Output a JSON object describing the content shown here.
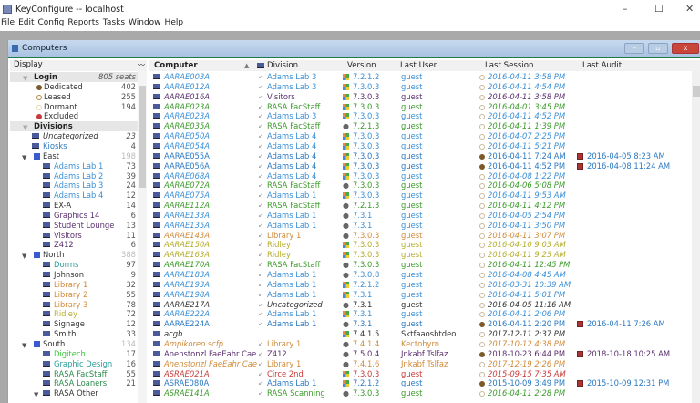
{
  "window": {
    "title": "KeyConfigure -- localhost",
    "minimize": "–",
    "maximize": "☐",
    "close": "✕"
  },
  "menu": [
    "File",
    "Edit",
    "Config",
    "Reports",
    "Tasks",
    "Window",
    "Help"
  ],
  "inner_window": {
    "title": "Computers",
    "min": "–",
    "max": "▫",
    "close": "x"
  },
  "colors": {
    "blue": "#3a8fd6",
    "dblue": "#2a78c2",
    "purple": "#5a2f6e",
    "green": "#3a9a2a",
    "orange": "#d08a3a",
    "olive": "#b5ad2c",
    "dark": "#333333",
    "red": "#c83a3a",
    "teal": "#2a9a9a",
    "lgreen": "#3ac83a",
    "dgreen": "#2a8a4a"
  },
  "left": {
    "header": "Display",
    "header_icon": "chart-wave-icon",
    "rows": [
      {
        "type": "section",
        "label": "Login",
        "count": "805 seats"
      },
      {
        "type": "login",
        "dot": "#7a5a2a",
        "label": "Dedicated",
        "count": "402"
      },
      {
        "type": "login",
        "dot": "#b08a40",
        "ring": true,
        "label": "Leased",
        "count": "255"
      },
      {
        "type": "login",
        "dot": "#e8d8b0",
        "ring": true,
        "label": "Dormant",
        "count": "194"
      },
      {
        "type": "login",
        "dot": "#c83a3a",
        "label": "Excluded",
        "count": ""
      },
      {
        "type": "section",
        "label": "Divisions",
        "count": ""
      },
      {
        "type": "div",
        "level": 0,
        "label": "Uncategorized",
        "count": "23",
        "color": "dark",
        "italic": true
      },
      {
        "type": "div",
        "level": 0,
        "label": "Kiosks",
        "count": "4",
        "color": "dblue"
      },
      {
        "type": "grp",
        "label": "East",
        "count": "198"
      },
      {
        "type": "div",
        "level": 1,
        "label": "Adams Lab 1",
        "count": "73",
        "color": "blue"
      },
      {
        "type": "div",
        "level": 1,
        "label": "Adams Lab 2",
        "count": "39",
        "color": "blue"
      },
      {
        "type": "div",
        "level": 1,
        "label": "Adams Lab 3",
        "count": "24",
        "color": "blue"
      },
      {
        "type": "div",
        "level": 1,
        "label": "Adams Lab 4",
        "count": "12",
        "color": "blue"
      },
      {
        "type": "div",
        "level": 1,
        "label": "EX-A",
        "count": "14",
        "color": "dark"
      },
      {
        "type": "div",
        "level": 1,
        "label": "Graphics 14",
        "count": "6",
        "color": "purple"
      },
      {
        "type": "div",
        "level": 1,
        "label": "Student Lounge",
        "count": "13",
        "color": "purple"
      },
      {
        "type": "div",
        "level": 1,
        "label": "Visitors",
        "count": "11",
        "color": "purple"
      },
      {
        "type": "div",
        "level": 1,
        "label": "Z412",
        "count": "6",
        "color": "purple"
      },
      {
        "type": "grp",
        "label": "North",
        "count": "388"
      },
      {
        "type": "div",
        "level": 1,
        "label": "Dorms",
        "count": "97",
        "color": "teal"
      },
      {
        "type": "div",
        "level": 1,
        "label": "Johnson",
        "count": "9",
        "color": "dark"
      },
      {
        "type": "div",
        "level": 1,
        "label": "Library 1",
        "count": "32",
        "color": "orange"
      },
      {
        "type": "div",
        "level": 1,
        "label": "Library 2",
        "count": "55",
        "color": "orange"
      },
      {
        "type": "div",
        "level": 1,
        "label": "Library 3",
        "count": "78",
        "color": "orange"
      },
      {
        "type": "div",
        "level": 1,
        "label": "Ridley",
        "count": "72",
        "color": "olive"
      },
      {
        "type": "div",
        "level": 1,
        "label": "Signage",
        "count": "12",
        "color": "dark"
      },
      {
        "type": "div",
        "level": 1,
        "label": "Smith",
        "count": "33",
        "color": "dark"
      },
      {
        "type": "grp",
        "label": "South",
        "count": "134"
      },
      {
        "type": "div",
        "level": 1,
        "label": "Digitech",
        "count": "17",
        "color": "lgreen"
      },
      {
        "type": "div",
        "level": 1,
        "label": "Graphic Design",
        "count": "16",
        "color": "teal"
      },
      {
        "type": "div",
        "level": 1,
        "label": "RASA FacStaff",
        "count": "55",
        "color": "dgreen"
      },
      {
        "type": "div",
        "level": 1,
        "label": "RASA Loaners",
        "count": "21",
        "color": "dgreen"
      },
      {
        "type": "div",
        "level": 1,
        "label": "RASA Other",
        "count": "",
        "color": "dark",
        "expanded": true
      }
    ]
  },
  "table": {
    "columns": [
      "Computer",
      "Division",
      "Version",
      "Last User",
      "Last Session",
      "Last Audit"
    ],
    "sort": "ascending",
    "rows": [
      {
        "c": "AARAE003A",
        "d": "Adams Lab 3",
        "os": "windows",
        "v": "7.2.1.2",
        "u": "guest",
        "s": "2016-04-11   3:58 PM",
        "a": "",
        "col": "blue",
        "it": true
      },
      {
        "c": "AARAE012A",
        "d": "Adams Lab 3",
        "os": "windows",
        "v": "7.3.0.3",
        "u": "guest",
        "s": "2016-04-11   4:54 PM",
        "a": "",
        "col": "blue",
        "it": true
      },
      {
        "c": "AARAE016A",
        "d": "Visitors",
        "os": "windows",
        "v": "7.3.0.3",
        "u": "guest",
        "s": "2016-04-11   3:58 PM",
        "a": "",
        "col": "purple",
        "it": true
      },
      {
        "c": "AARAE023A",
        "d": "RASA FacStaff",
        "os": "windows",
        "v": "7.3.0.3",
        "u": "guest",
        "s": "2016-04-01   3:45 PM",
        "a": "",
        "col": "green",
        "it": true
      },
      {
        "c": "AARAE023A",
        "d": "Adams Lab 3",
        "os": "windows",
        "v": "7.3.0.3",
        "u": "guest",
        "s": "2016-04-11   4:52 PM",
        "a": "",
        "col": "blue",
        "it": true
      },
      {
        "c": "AARAE035A",
        "d": "RASA FacStaff",
        "os": "apple",
        "v": "7.2.1.3",
        "u": "guest",
        "s": "2016-04-11   1:39 PM",
        "a": "",
        "col": "green",
        "it": true
      },
      {
        "c": "AARAE050A",
        "d": "Adams Lab 4",
        "os": "windows",
        "v": "7.3.0.3",
        "u": "guest",
        "s": "2016-04-07   2:25 PM",
        "a": "",
        "col": "blue",
        "it": true
      },
      {
        "c": "AARAE054A",
        "d": "Adams Lab 4",
        "os": "windows",
        "v": "7.3.0.3",
        "u": "guest",
        "s": "2016-04-11   5:21 PM",
        "a": "",
        "col": "blue",
        "it": true
      },
      {
        "c": "AARAE055A",
        "d": "Adams Lab 4",
        "os": "windows",
        "v": "7.3.0.3",
        "u": "guest",
        "s": "2016-04-11   7:24 AM",
        "a": "2016-04-05   8:23 AM",
        "col": "dblue",
        "it": false
      },
      {
        "c": "AARAE056A",
        "d": "Adams Lab 4",
        "os": "windows",
        "v": "7.3.0.3",
        "u": "guest",
        "s": "2016-04-11   4:52 PM",
        "a": "2016-04-08   11:24 AM",
        "col": "dblue",
        "it": false
      },
      {
        "c": "AARAE068A",
        "d": "Adams Lab 4",
        "os": "windows",
        "v": "7.3.0.3",
        "u": "guest",
        "s": "2016-04-08   1:22 PM",
        "a": "",
        "col": "blue",
        "it": true
      },
      {
        "c": "AARAE072A",
        "d": "RASA FacStaff",
        "os": "apple",
        "v": "7.3.0.3",
        "u": "guest",
        "s": "2016-04-06   5:08 PM",
        "a": "",
        "col": "green",
        "it": true
      },
      {
        "c": "AARAE075A",
        "d": "Adams Lab 1",
        "os": "windows",
        "v": "7.3.0.3",
        "u": "guest",
        "s": "2016-04-11   9:53 AM",
        "a": "",
        "col": "blue",
        "it": true
      },
      {
        "c": "AARAE112A",
        "d": "RASA FacStaff",
        "os": "apple",
        "v": "7.2.1.3",
        "u": "guest",
        "s": "2016-04-11   4:12 PM",
        "a": "",
        "col": "green",
        "it": true
      },
      {
        "c": "AARAE133A",
        "d": "Adams Lab 1",
        "os": "apple",
        "v": "7.3.1",
        "u": "guest",
        "s": "2016-04-05   2:54 PM",
        "a": "",
        "col": "blue",
        "it": true
      },
      {
        "c": "AARAE135A",
        "d": "Adams Lab 1",
        "os": "apple",
        "v": "7.3.1",
        "u": "guest",
        "s": "2016-04-11   3:50 PM",
        "a": "",
        "col": "blue",
        "it": true
      },
      {
        "c": "AARAE143A",
        "d": "Library 1",
        "os": "apple",
        "v": "7.3.0.3",
        "u": "guest",
        "s": "2016-04-11   3:07 PM",
        "a": "",
        "col": "orange",
        "it": true
      },
      {
        "c": "AARAE150A",
        "d": "Ridley",
        "os": "windows",
        "v": "7.3.0.3",
        "u": "guest",
        "s": "2016-04-10   9:03 AM",
        "a": "",
        "col": "olive",
        "it": true
      },
      {
        "c": "AARAE163A",
        "d": "Ridley",
        "os": "windows",
        "v": "7.3.0.3",
        "u": "guest",
        "s": "2016-04-11   9:23 AM",
        "a": "",
        "col": "olive",
        "it": true
      },
      {
        "c": "AARAE170A",
        "d": "RASA FacStaff",
        "os": "apple",
        "v": "7.3.0.3",
        "u": "guest",
        "s": "2016-04-11   12:45 PM",
        "a": "",
        "col": "green",
        "it": true
      },
      {
        "c": "AARAE183A",
        "d": "Adams Lab 1",
        "os": "apple",
        "v": "7.3.0.8",
        "u": "guest",
        "s": "2016-04-08   4:45 AM",
        "a": "",
        "col": "blue",
        "it": true
      },
      {
        "c": "AARAE193A",
        "d": "Adams Lab 1",
        "os": "windows",
        "v": "7.2.1.2",
        "u": "guest",
        "s": "2016-03-31   10:39 AM",
        "a": "",
        "col": "blue",
        "it": true
      },
      {
        "c": "AARAE198A",
        "d": "Adams Lab 1",
        "os": "windows",
        "v": "7.3.1",
        "u": "guest",
        "s": "2016-04-11   5:01 PM",
        "a": "",
        "col": "blue",
        "it": true
      },
      {
        "c": "AARAE217A",
        "d": "Uncategorized",
        "os": "apple",
        "v": "7.3.1",
        "u": "guest",
        "s": "2016-04-05   11:16 AM",
        "a": "",
        "col": "dark",
        "it": true
      },
      {
        "c": "AARAE222A",
        "d": "Adams Lab 1",
        "os": "windows",
        "v": "7.3.1",
        "u": "guest",
        "s": "2016-04-11   2:06 PM",
        "a": "",
        "col": "blue",
        "it": true
      },
      {
        "c": "AARAE224A",
        "d": "Adams Lab 1",
        "os": "apple",
        "v": "7.3.1",
        "u": "guest",
        "s": "2016-04-11   2:20 PM",
        "a": "2016-04-11   7:26 AM",
        "col": "dblue",
        "it": false
      },
      {
        "c": "acgb",
        "d": "",
        "os": "windows",
        "v": "7.4.1.5",
        "u": "Sktfaaosbtdeo",
        "s": "2017-12-11   2:37 PM",
        "a": "",
        "col": "dark",
        "it": true
      },
      {
        "c": "Ampikoreo scfp",
        "d": "Library 1",
        "os": "apple",
        "v": "7.4.1.4",
        "u": "Kectobyrn",
        "s": "2017-10-12   4:38 PM",
        "a": "",
        "col": "orange",
        "it": true
      },
      {
        "c": "Anenstonzl FaeEahr Cae",
        "d": "Z412",
        "os": "apple",
        "v": "7.5.0.4",
        "u": "Jnkabf Tslfaz",
        "s": "2018-10-23   6:44 PM",
        "a": "2018-10-18   10:25 AM",
        "col": "purple",
        "it": false
      },
      {
        "c": "Anenstonzl FaeEahr Cae",
        "d": "Library 1",
        "os": "apple",
        "v": "7.4.1.6",
        "u": "Jnkabf Tslfaz",
        "s": "2017-12-19   2:26 PM",
        "a": "",
        "col": "orange",
        "it": true
      },
      {
        "c": "ASRAE021A",
        "d": "Circe 2nd",
        "os": "windows",
        "v": "7.3.0.3",
        "u": "guest",
        "s": "2015-09-15   7:35 AM",
        "a": "",
        "col": "red",
        "it": true
      },
      {
        "c": "ASRAE080A",
        "d": "Adams Lab 1",
        "os": "windows",
        "v": "7.2.1.2",
        "u": "guest",
        "s": "2015-10-09   3:49 PM",
        "a": "2015-10-09   12:31 PM",
        "col": "dblue",
        "it": false
      },
      {
        "c": "ASRAE141A",
        "d": "RASA Scanning",
        "os": "apple",
        "v": "7.3.0.3",
        "u": "guest",
        "s": "2016-04-11   2:28 PM",
        "a": "",
        "col": "green",
        "it": true
      }
    ]
  }
}
